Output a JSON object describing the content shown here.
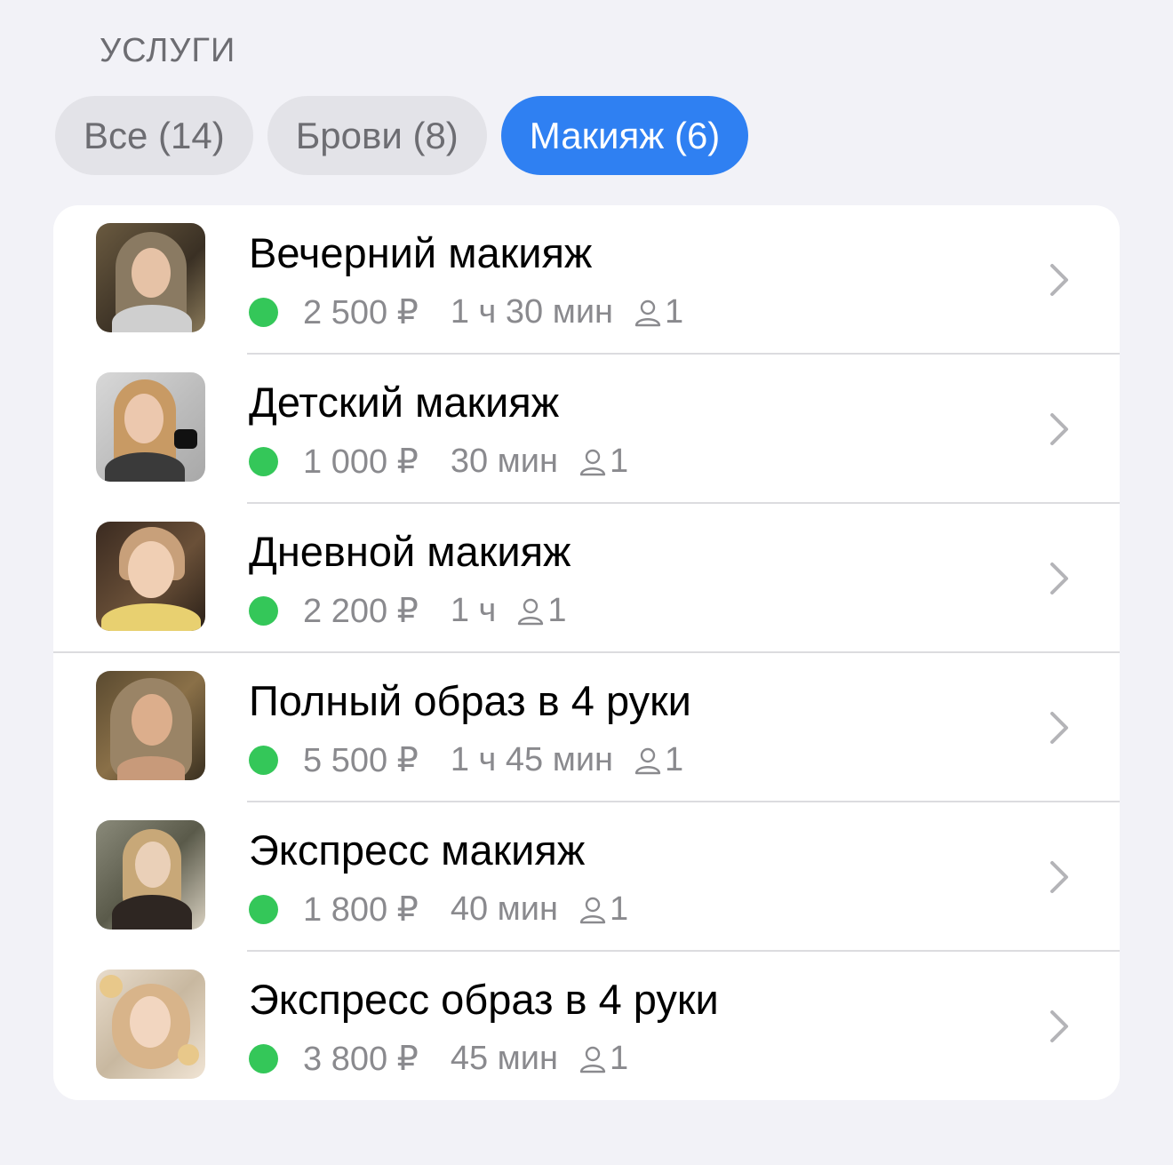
{
  "section": {
    "title": "УСЛУГИ"
  },
  "filters": [
    {
      "label": "Все (14)",
      "active": false
    },
    {
      "label": "Брови (8)",
      "active": false
    },
    {
      "label": "Макияж (6)",
      "active": true
    }
  ],
  "services": [
    {
      "title": "Вечерний макияж",
      "price": "2 500 ₽",
      "duration": "1 ч 30 мин",
      "people": "1",
      "status_color": "#34c759"
    },
    {
      "title": "Детский макияж",
      "price": "1 000 ₽",
      "duration": "30 мин",
      "people": "1",
      "status_color": "#34c759"
    },
    {
      "title": "Дневной макияж",
      "price": "2 200 ₽",
      "duration": "1 ч",
      "people": "1",
      "status_color": "#34c759"
    },
    {
      "title": "Полный образ в 4 руки",
      "price": "5 500 ₽",
      "duration": "1 ч 45 мин",
      "people": "1",
      "status_color": "#34c759"
    },
    {
      "title": "Экспресс макияж",
      "price": "1 800 ₽",
      "duration": "40 мин",
      "people": "1",
      "status_color": "#34c759"
    },
    {
      "title": "Экспресс образ в 4 руки",
      "price": "3 800 ₽",
      "duration": "45 мин",
      "people": "1",
      "status_color": "#34c759"
    }
  ],
  "colors": {
    "accent": "#2f80f2",
    "status_active": "#34c759",
    "background": "#f2f2f7"
  }
}
